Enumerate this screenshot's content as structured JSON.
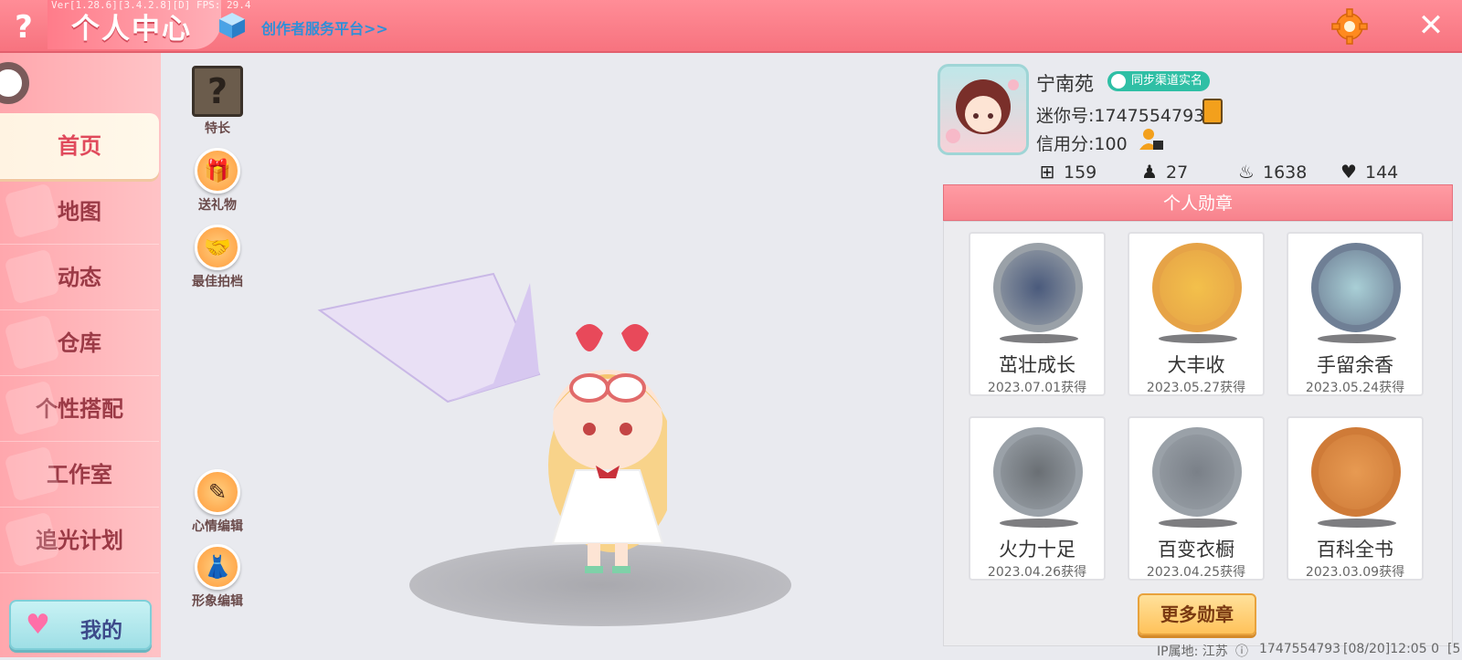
{
  "debug_version": "Ver[1.28.6][3.4.2.8][D] FPS: 29.4",
  "header": {
    "help_glyph": "?",
    "title": "个人中心",
    "creator_link": "创作者服务平台>>",
    "close_glyph": "✕",
    "icons": [
      "help-icon",
      "cube-icon",
      "gear-icon",
      "close-icon"
    ]
  },
  "nav": {
    "items": [
      "首页",
      "地图",
      "动态",
      "仓库",
      "个性搭配",
      "工作室",
      "追光计划"
    ],
    "active": "首页",
    "mine_label": "我的"
  },
  "actions": {
    "specialty": "特长",
    "gift": "送礼物",
    "best_partner": "最佳拍档",
    "mood_edit": "心情编辑",
    "look_edit": "形象编辑"
  },
  "profile": {
    "username": "宁南苑",
    "real_name_badge": "同步渠道实名",
    "mini_id": "迷你号:1747554793",
    "credit": "信用分:100",
    "stats": [
      {
        "icon": "add-friend-icon",
        "value": "159"
      },
      {
        "icon": "fans-icon",
        "value": "27"
      },
      {
        "icon": "fire-icon",
        "value": "1638"
      },
      {
        "icon": "heart-icon",
        "value": "144"
      }
    ]
  },
  "medals": {
    "title": "个人勋章",
    "items": [
      {
        "name": "茁壮成长",
        "date": "2023.07.01获得",
        "ring": "#9aa1a8",
        "fill": "#4a5a7c"
      },
      {
        "name": "大丰收",
        "date": "2023.05.27获得",
        "ring": "#e6a347",
        "fill": "#f3c04b"
      },
      {
        "name": "手留余香",
        "date": "2023.05.24获得",
        "ring": "#6f7f95",
        "fill": "#a9cfd6"
      },
      {
        "name": "火力十足",
        "date": "2023.04.26获得",
        "ring": "#9aa1a8",
        "fill": "#6a6f74"
      },
      {
        "name": "百变衣橱",
        "date": "2023.04.25获得",
        "ring": "#9aa1a8",
        "fill": "#7a8088"
      },
      {
        "name": "百科全书",
        "date": "2023.03.09获得",
        "ring": "#cf7b38",
        "fill": "#e79a52"
      }
    ],
    "more_button": "更多勋章"
  },
  "footer": {
    "ip_location": "IP属地: 江苏",
    "id": "1747554793",
    "timestamp": "[08/20]12:05 0",
    "trail": "[5"
  },
  "colors": {
    "header_pink": "#f7737f",
    "sidebar_pink": "#ffb4b9",
    "accent_orange": "#ff9a3a",
    "badge_teal": "#2fbfa5"
  }
}
